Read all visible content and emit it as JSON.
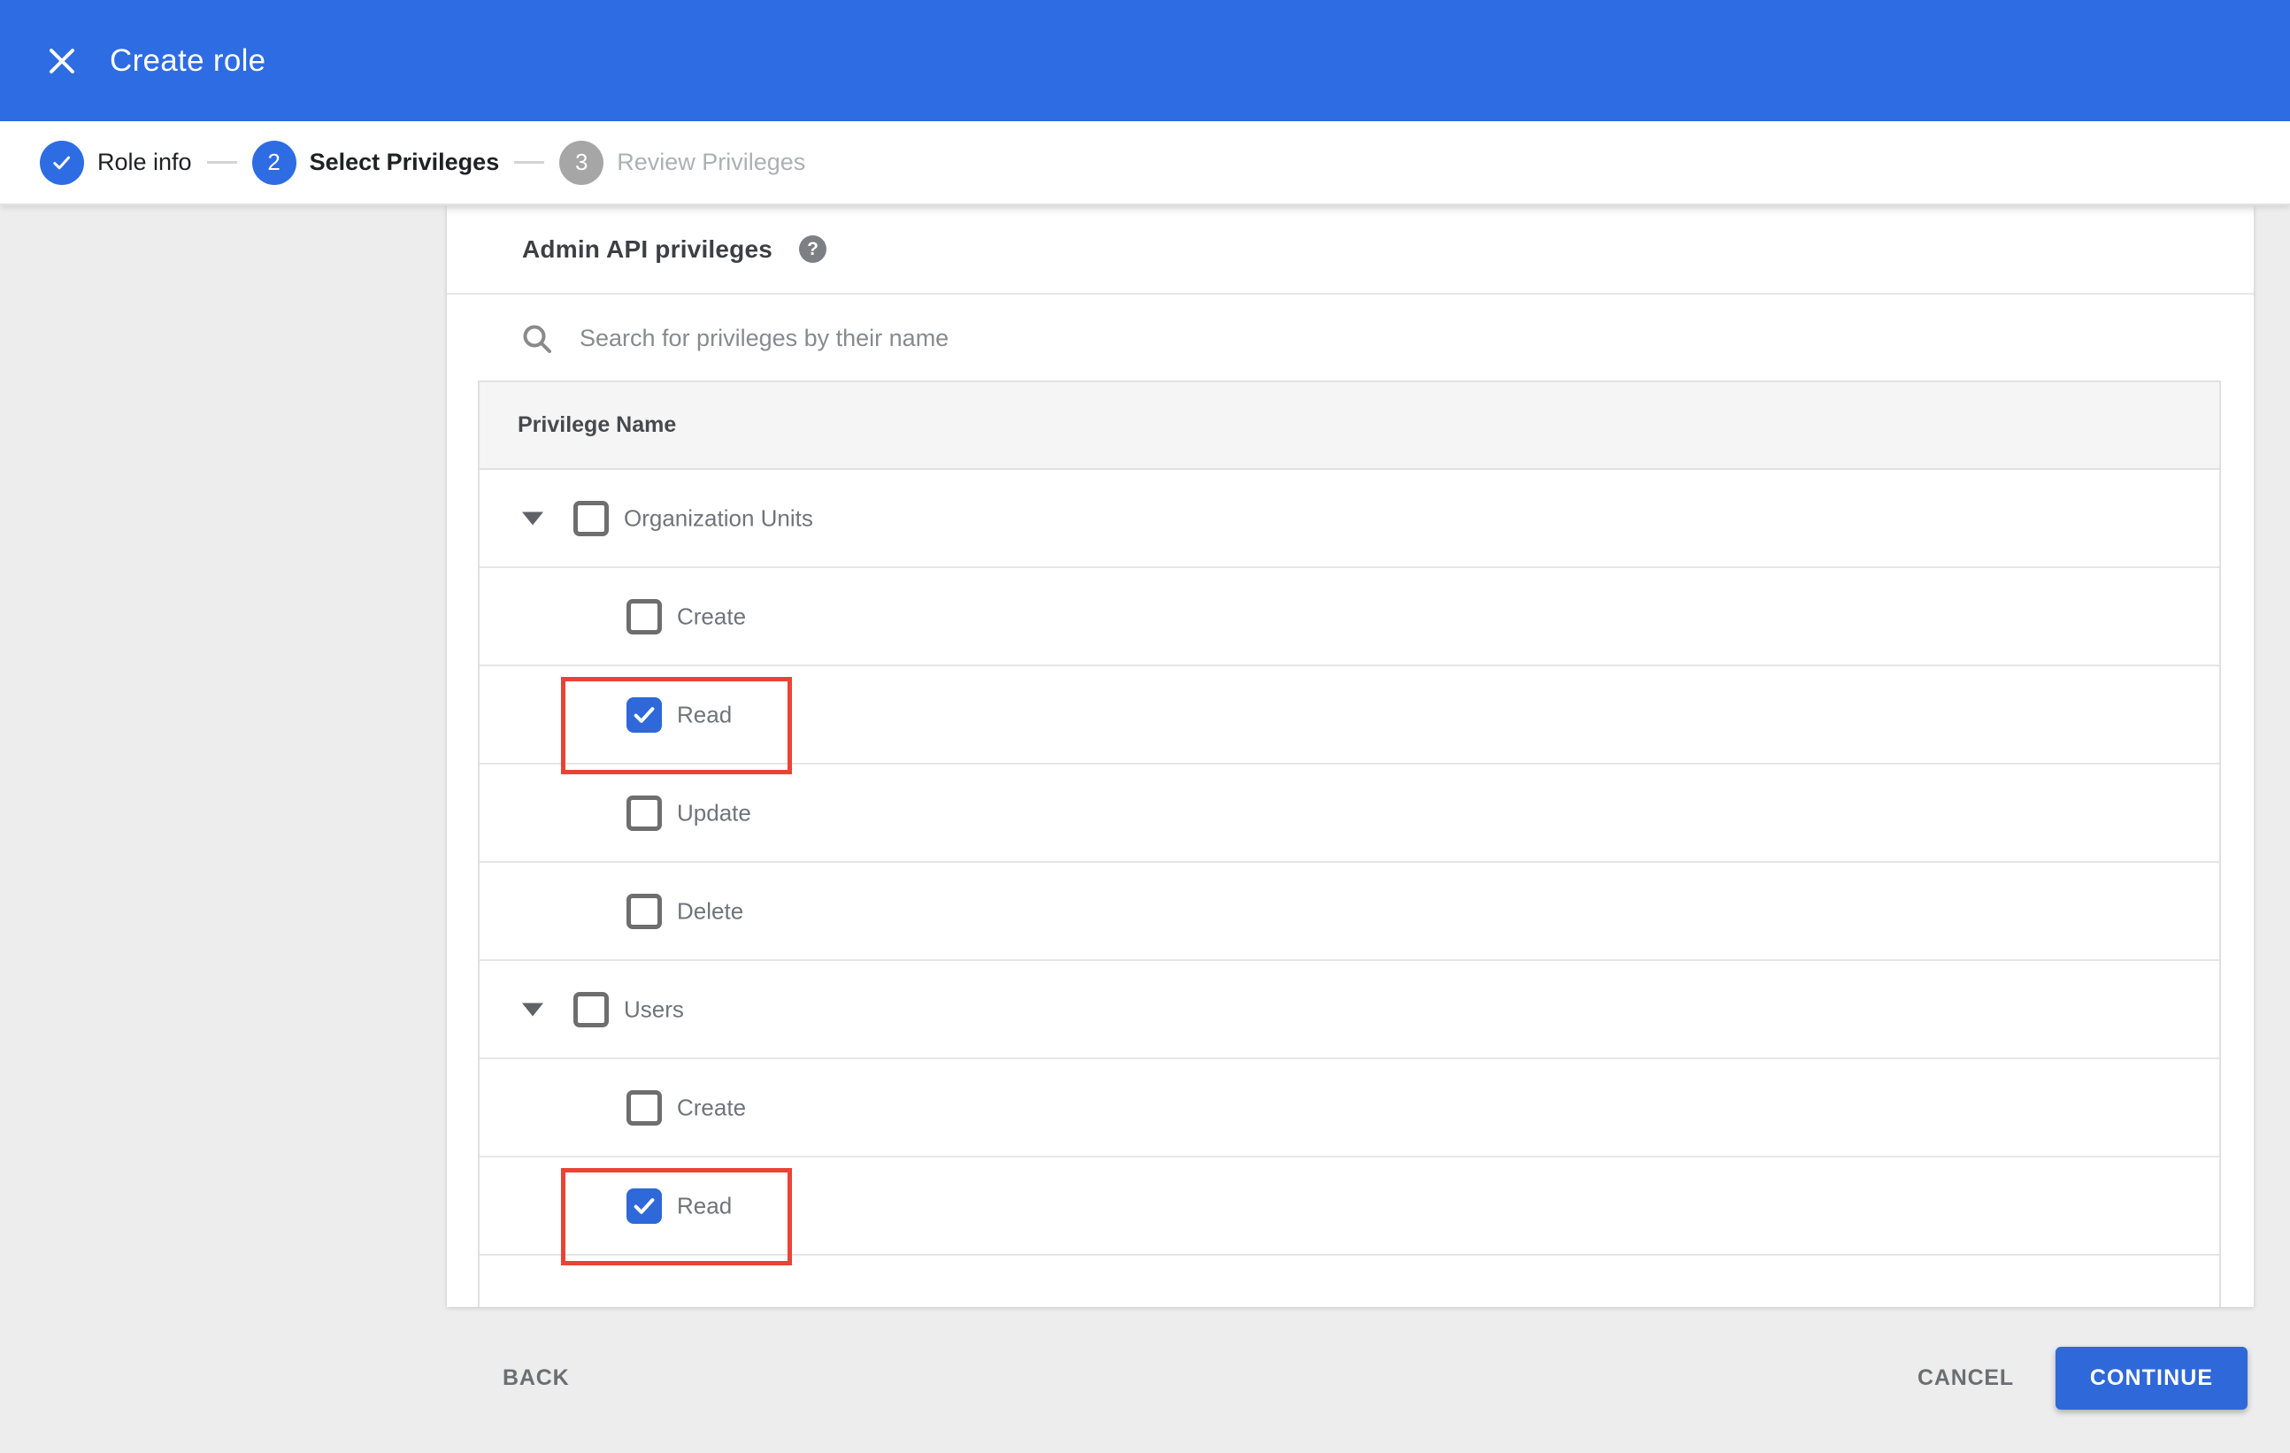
{
  "colors": {
    "app_bar_blue": "#2d6ce2",
    "checkbox_blue": "#2e68d9",
    "button_blue": "#2e68d9",
    "highlight_red": "#ea4335",
    "page_gray": "#ededed",
    "table_header_gray": "#f5f5f6"
  },
  "app_bar": {
    "title": "Create role"
  },
  "stepper": {
    "steps": [
      {
        "number": "1",
        "label": "Role info",
        "state": "done"
      },
      {
        "number": "2",
        "label": "Select Privileges",
        "state": "active"
      },
      {
        "number": "3",
        "label": "Review Privileges",
        "state": "upcoming"
      }
    ]
  },
  "content": {
    "heading": "Admin API privileges",
    "help_icon": "?",
    "search": {
      "placeholder": "Search for privileges by their name",
      "value": ""
    },
    "table": {
      "header": "Privilege Name",
      "rows": [
        {
          "type": "group",
          "label": "Organization Units",
          "checked": false,
          "expanded": true,
          "highlight": false
        },
        {
          "type": "child",
          "label": "Create",
          "checked": false,
          "highlight": false
        },
        {
          "type": "child",
          "label": "Read",
          "checked": true,
          "highlight": true
        },
        {
          "type": "child",
          "label": "Update",
          "checked": false,
          "highlight": false
        },
        {
          "type": "child",
          "label": "Delete",
          "checked": false,
          "highlight": false
        },
        {
          "type": "group",
          "label": "Users",
          "checked": false,
          "expanded": true,
          "highlight": false
        },
        {
          "type": "child",
          "label": "Create",
          "checked": false,
          "highlight": false
        },
        {
          "type": "child",
          "label": "Read",
          "checked": true,
          "highlight": true
        },
        {
          "type": "partial",
          "label": "",
          "checked": false,
          "highlight": false
        }
      ]
    }
  },
  "footer": {
    "back_label": "BACK",
    "cancel_label": "CANCEL",
    "continue_label": "CONTINUE"
  }
}
